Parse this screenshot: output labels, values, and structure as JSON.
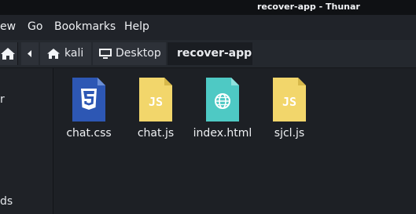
{
  "window": {
    "title": "recover-app - Thunar"
  },
  "menubar": {
    "items": [
      {
        "label": "ew"
      },
      {
        "label": "Go"
      },
      {
        "label": "Bookmarks"
      },
      {
        "label": "Help"
      }
    ]
  },
  "pathbar": {
    "crumbs": [
      {
        "label": "kali",
        "icon": "home-icon"
      },
      {
        "label": "Desktop",
        "icon": "desktop-icon"
      },
      {
        "label": "recover-app"
      }
    ]
  },
  "sidebar": {
    "fragments": [
      {
        "label": "r"
      },
      {
        "label": "ds"
      }
    ]
  },
  "files": [
    {
      "name": "chat.css",
      "type": "css",
      "color": "#2d57b4"
    },
    {
      "name": "chat.js",
      "type": "js",
      "color": "#f2d66b"
    },
    {
      "name": "index.html",
      "type": "html",
      "color": "#4ec9c4"
    },
    {
      "name": "sjcl.js",
      "type": "js",
      "color": "#f2d66b"
    }
  ]
}
